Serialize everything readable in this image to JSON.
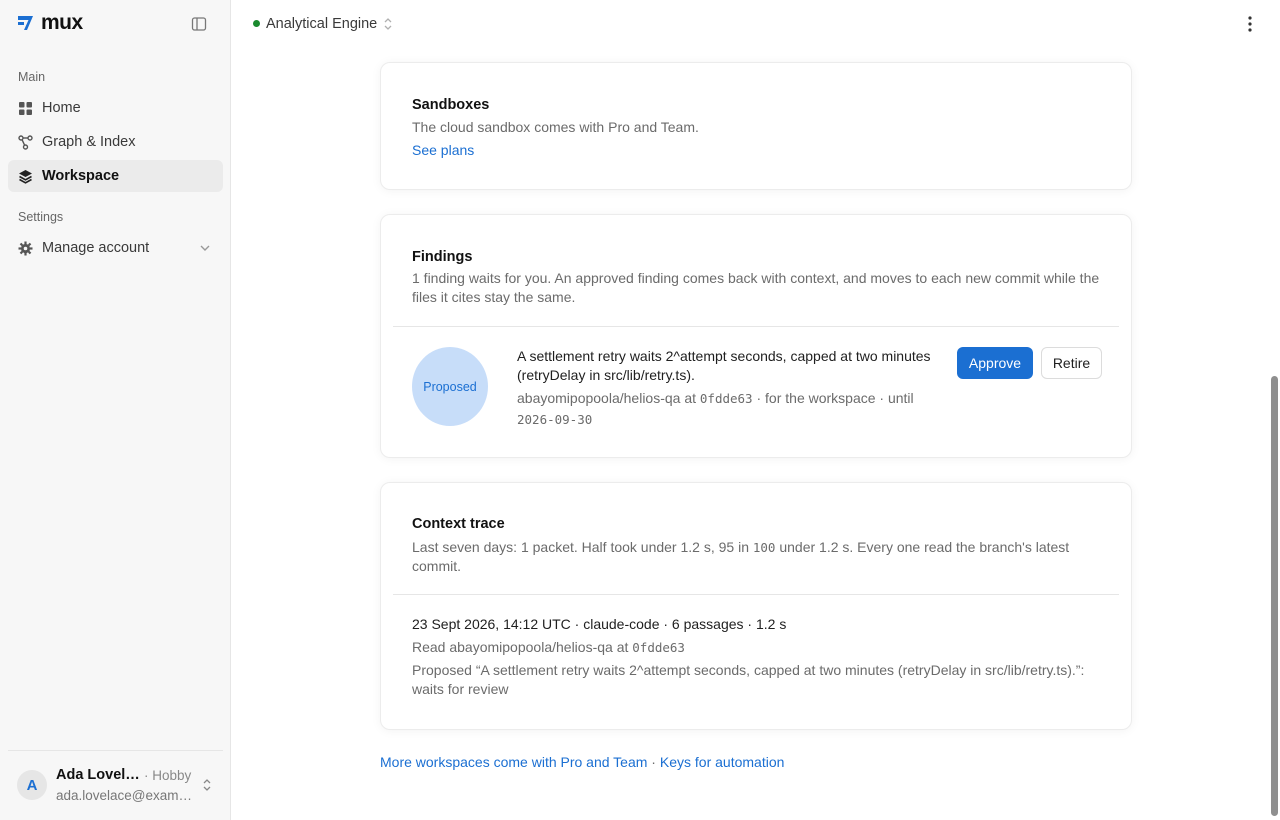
{
  "app": {
    "brand": "mux"
  },
  "sidebar": {
    "main_title": "Main",
    "settings_title": "Settings",
    "items": [
      {
        "label": "Home",
        "icon": "home-icon"
      },
      {
        "label": "Graph & Index",
        "icon": "graph-icon"
      },
      {
        "label": "Workspace",
        "icon": "layers-icon",
        "active": true
      }
    ],
    "manage": {
      "label": "Manage account",
      "icon": "gear-icon"
    },
    "user": {
      "initial": "A",
      "name": "Ada Lovelace",
      "plan": "· Hobby",
      "email": "ada.lovelace@example.com"
    }
  },
  "topbar": {
    "workspace": "Analytical Engine",
    "status_color": "#1a8a2e"
  },
  "sandboxes": {
    "title": "Sandboxes",
    "text": "The cloud sandbox comes with Pro and Team.",
    "link": "See plans"
  },
  "findings": {
    "title": "Findings",
    "text": "1 finding waits for you. An approved finding comes back with context, and moves to each new commit while the files it cites stay the same.",
    "item": {
      "status": "Proposed",
      "claim": "A settlement retry waits 2^attempt seconds, capped at two minutes (retryDelay in src/lib/retry.ts).",
      "repo": "abayomipopoola/helios-qa at",
      "commit": "0fdde63",
      "scope": "· for the workspace · until",
      "until": "2026-09-30",
      "approve": "Approve",
      "retire": "Retire"
    }
  },
  "trace": {
    "title": "Context trace",
    "summary_before": "Last seven days: 1 packet. Half took under 1.2 s, 95 in",
    "summary_mono": "100",
    "summary_after": "under 1.2 s. Every one read the branch's latest commit.",
    "entry": {
      "head": "23 Sept 2026, 14:12 UTC · claude-code · 6 passages · 1.2 s",
      "read_prefix": "Read abayomipopoola/helios-qa at",
      "read_commit": "0fdde63",
      "proposed": "Proposed “A settlement retry waits 2^attempt seconds, capped at two minutes (retryDelay in src/lib/retry.ts).”: waits for review"
    }
  },
  "footer": {
    "link1": "More workspaces come with Pro and Team",
    "sep": " · ",
    "link2": "Keys for automation"
  },
  "colors": {
    "accent": "#1b6fd2",
    "badge_bg": "#c7ddf9",
    "sidebar_bg": "#f7f7f7"
  }
}
